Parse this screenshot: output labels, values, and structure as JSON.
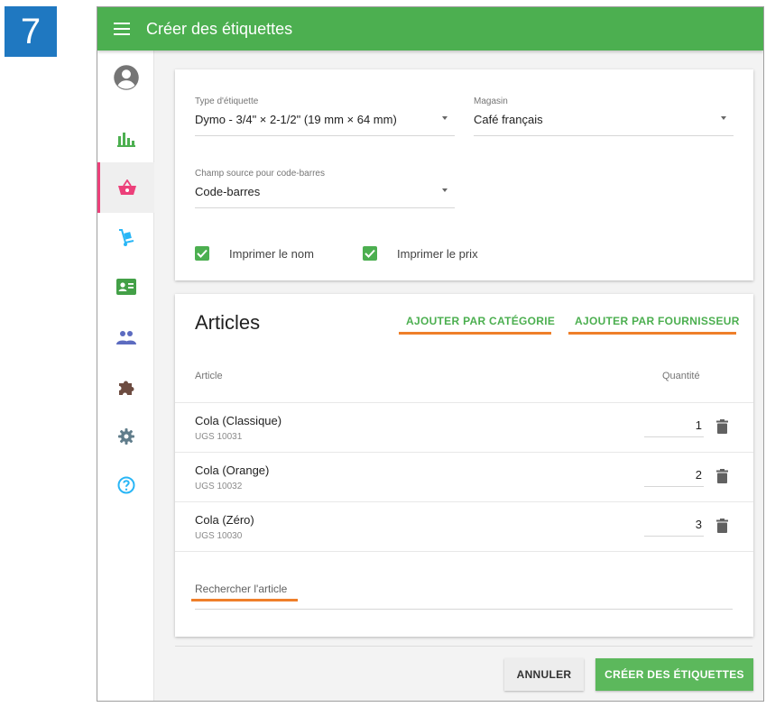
{
  "step_number": "7",
  "header": {
    "title": "Créer des étiquettes"
  },
  "colors": {
    "accent": "#4caf50",
    "highlight": "#ef7f2a",
    "badge": "#1f78c1",
    "active_nav": "#ec407a"
  },
  "sidebar": {
    "items": [
      {
        "icon": "account-circle-icon",
        "color": "#757575"
      },
      {
        "icon": "bar-chart-icon",
        "color": "#4caf50"
      },
      {
        "icon": "shopping-basket-icon",
        "color": "#ec407a",
        "active": true
      },
      {
        "icon": "dolly-icon",
        "color": "#29b6f6"
      },
      {
        "icon": "contact-card-icon",
        "color": "#43a047"
      },
      {
        "icon": "people-icon",
        "color": "#5c6bc0"
      },
      {
        "icon": "puzzle-icon",
        "color": "#6d4c41"
      },
      {
        "icon": "gear-icon",
        "color": "#607d8b"
      },
      {
        "icon": "help-icon",
        "color": "#29b6f6"
      }
    ]
  },
  "settings": {
    "label_type": {
      "label": "Type d'étiquette",
      "value": "Dymo - 3/4\" × 2-1/2\" (19 mm × 64 mm)"
    },
    "store": {
      "label": "Magasin",
      "value": "Café français"
    },
    "barcode_source": {
      "label": "Champ source pour code-barres",
      "value": "Code-barres"
    },
    "print_name": {
      "label": "Imprimer le nom",
      "checked": true
    },
    "print_price": {
      "label": "Imprimer le prix",
      "checked": true
    }
  },
  "articles": {
    "title": "Articles",
    "add_by_category": "AJOUTER PAR CATÉGORIE",
    "add_by_supplier": "AJOUTER PAR FOURNISSEUR",
    "columns": {
      "article": "Article",
      "quantity": "Quantité"
    },
    "rows": [
      {
        "name": "Cola (Classique)",
        "sku": "UGS 10031",
        "quantity": "1"
      },
      {
        "name": "Cola (Orange)",
        "sku": "UGS 10032",
        "quantity": "2"
      },
      {
        "name": "Cola (Zéro)",
        "sku": "UGS 10030",
        "quantity": "3"
      }
    ],
    "search_placeholder": "Rechercher l'article"
  },
  "actions": {
    "cancel": "ANNULER",
    "create": "CRÉER DES ÉTIQUETTES"
  }
}
